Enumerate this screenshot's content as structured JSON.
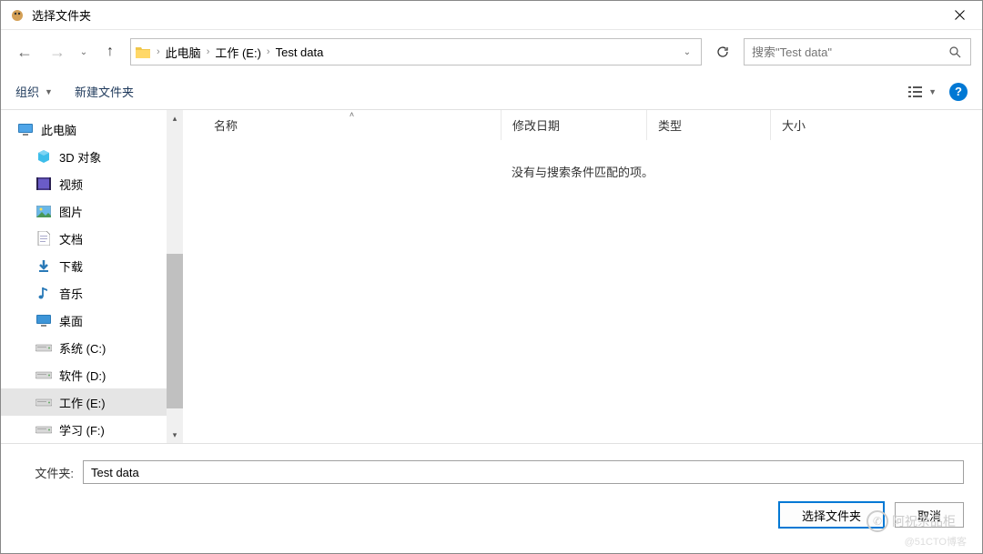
{
  "title": "选择文件夹",
  "breadcrumb": [
    "此电脑",
    "工作 (E:)",
    "Test data"
  ],
  "search": {
    "placeholder": "搜索\"Test data\""
  },
  "toolbar": {
    "organize": "组织",
    "newfolder": "新建文件夹"
  },
  "columns": {
    "name": "名称",
    "date": "修改日期",
    "type": "类型",
    "size": "大小"
  },
  "empty_message": "没有与搜索条件匹配的项。",
  "tree": {
    "root": "此电脑",
    "items": [
      {
        "label": "3D 对象",
        "icon": "3d"
      },
      {
        "label": "视频",
        "icon": "video"
      },
      {
        "label": "图片",
        "icon": "picture"
      },
      {
        "label": "文档",
        "icon": "document"
      },
      {
        "label": "下载",
        "icon": "download"
      },
      {
        "label": "音乐",
        "icon": "music"
      },
      {
        "label": "桌面",
        "icon": "desktop"
      },
      {
        "label": "系统 (C:)",
        "icon": "drive"
      },
      {
        "label": "软件 (D:)",
        "icon": "drive"
      },
      {
        "label": "工作 (E:)",
        "icon": "drive",
        "selected": true
      },
      {
        "label": "学习 (F:)",
        "icon": "drive"
      }
    ]
  },
  "folder": {
    "label": "文件夹:",
    "value": "Test data"
  },
  "buttons": {
    "select": "选择文件夹",
    "cancel": "取消"
  },
  "watermark": "阿祝杂品柜",
  "watermark2": "@51CTO博客"
}
